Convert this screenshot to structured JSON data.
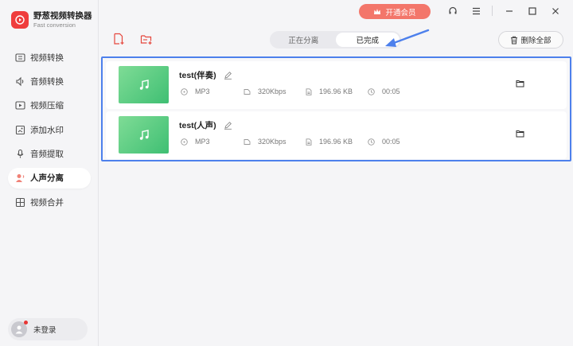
{
  "app": {
    "title": "野葱视频转换器",
    "subtitle": "Fast conversion"
  },
  "header": {
    "vip_label": "开通会员"
  },
  "sidebar": {
    "items": [
      {
        "label": "视频转换",
        "icon": "video-convert-icon"
      },
      {
        "label": "音频转换",
        "icon": "audio-convert-icon"
      },
      {
        "label": "视频压缩",
        "icon": "video-compress-icon"
      },
      {
        "label": "添加水印",
        "icon": "watermark-icon"
      },
      {
        "label": "音频提取",
        "icon": "audio-extract-icon"
      },
      {
        "label": "人声分离",
        "icon": "vocal-separate-icon",
        "active": true
      },
      {
        "label": "视频合并",
        "icon": "video-merge-icon"
      }
    ],
    "user_label": "未登录"
  },
  "toolbar": {
    "tabs": [
      {
        "label": "正在分离",
        "active": false
      },
      {
        "label": "已完成",
        "active": true
      }
    ],
    "delete_all_label": "删除全部"
  },
  "files": [
    {
      "name": "test(伴奏)",
      "format": "MP3",
      "bitrate": "320Kbps",
      "size": "196.96 KB",
      "duration": "00:05"
    },
    {
      "name": "test(人声)",
      "format": "MP3",
      "bitrate": "320Kbps",
      "size": "196.96 KB",
      "duration": "00:05"
    }
  ],
  "colors": {
    "accent": "#f3766a",
    "brand": "#ef3d3d",
    "thumb_green": "#3fbf73",
    "annotation_blue": "#4d80ec"
  }
}
